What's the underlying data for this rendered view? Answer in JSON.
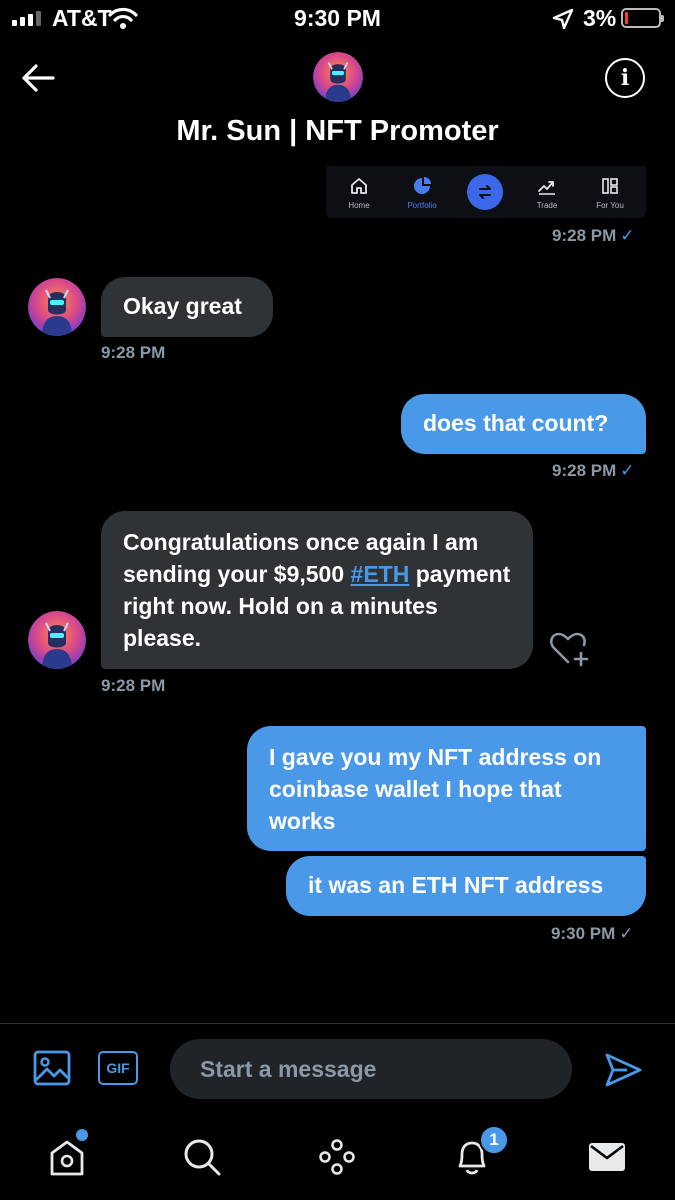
{
  "status_bar": {
    "carrier": "AT&T",
    "time": "9:30 PM",
    "battery_percent": "3%",
    "battery_level": 0.03,
    "signal_bars": 3,
    "icons": [
      "signal-bars-icon",
      "wifi-icon",
      "location-arrow-icon",
      "battery-icon"
    ]
  },
  "header": {
    "title": "Mr. Sun | NFT Promoter",
    "back_icon": "arrow-left-icon",
    "info_icon": "info-icon"
  },
  "snippet_nav": {
    "items": [
      {
        "label": "Home",
        "icon": "home-icon",
        "active": false
      },
      {
        "label": "Portfolio",
        "icon": "pie-chart-icon",
        "active": true
      },
      {
        "label": "",
        "icon": "swap-arrows-icon",
        "active": false
      },
      {
        "label": "Trade",
        "icon": "trend-chart-icon",
        "active": false
      },
      {
        "label": "For You",
        "icon": "grid-icon",
        "active": false
      }
    ],
    "timestamp": "9:28 PM"
  },
  "messages": [
    {
      "direction": "in",
      "text": "Okay great",
      "time": "9:28 PM"
    },
    {
      "direction": "out",
      "text": "does that count?",
      "time": "9:28 PM",
      "status": "read"
    },
    {
      "direction": "in",
      "text_before": "Congratulations once again I am sending your  $9,500",
      "hashtag": "#ETH",
      "text_after": "payment right now. Hold on a minutes please.",
      "time": "9:28 PM"
    },
    {
      "direction": "out",
      "text": "I gave you my NFT address on coinbase wallet I hope that works"
    },
    {
      "direction": "out",
      "text": "it was an ETH NFT address",
      "time": "9:30 PM",
      "status": "sent"
    }
  ],
  "composer": {
    "placeholder": "Start a message",
    "gif_label": "GIF",
    "icons": [
      "image-icon",
      "gif-icon",
      "send-icon",
      "heart-plus-icon"
    ]
  },
  "tab_bar": {
    "notifications_badge": "1",
    "icons": [
      "home-icon",
      "search-icon",
      "spaces-icon",
      "notifications-icon",
      "messages-icon"
    ]
  },
  "colors": {
    "accent": "#4a98e8",
    "incoming_bubble": "#2f3336",
    "background": "#000000",
    "muted_text": "#8b98a5"
  }
}
